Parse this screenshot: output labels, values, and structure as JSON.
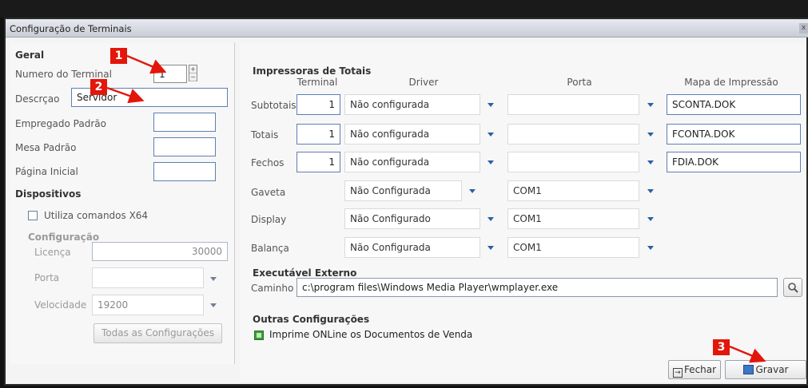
{
  "window": {
    "title": "Configuração de Terminais",
    "close_glyph": "x"
  },
  "left": {
    "section_geral": "Geral",
    "numero_terminal": {
      "label": "Numero do Terminal",
      "value": "1"
    },
    "descricao": {
      "label": "Descrçao",
      "value": "Servidor"
    },
    "empregado_padrao": {
      "label": "Empregado Padrão",
      "value": ""
    },
    "mesa_padrao": {
      "label": "Mesa Padrão",
      "value": ""
    },
    "pagina_inicial": {
      "label": "Página Inicial",
      "value": ""
    },
    "section_dispositivos": "Dispositivos",
    "utiliza_x64": {
      "label": "Utiliza comandos X64",
      "checked": false
    },
    "configuracao": {
      "title": "Configuração",
      "licenca": {
        "label": "Licença",
        "value": "30000"
      },
      "porta": {
        "label": "Porta",
        "value": ""
      },
      "velocidade": {
        "label": "Velocidade",
        "value": "19200"
      },
      "todas_button": "Todas as Configurações"
    }
  },
  "impressoras": {
    "title": "Impressoras de Totais",
    "headers": {
      "terminal": "Terminal",
      "driver": "Driver",
      "porta": "Porta",
      "mapa": "Mapa de Impressão"
    },
    "rows": [
      {
        "label": "Subtotais",
        "terminal": "1",
        "driver": "Não configurada",
        "porta": "",
        "mapa": "SCONTA.DOK"
      },
      {
        "label": "Totais",
        "terminal": "1",
        "driver": "Não configurada",
        "porta": "",
        "mapa": "FCONTA.DOK"
      },
      {
        "label": "Fechos",
        "terminal": "1",
        "driver": "Não configurada",
        "porta": "",
        "mapa": "FDIA.DOK"
      }
    ],
    "devices": [
      {
        "label": "Gaveta",
        "driver": "Não Configurada",
        "porta": "COM1"
      },
      {
        "label": "Display",
        "driver": "Não Configurado",
        "porta": "COM1"
      },
      {
        "label": "Balança",
        "driver": "Não Configurada",
        "porta": "COM1"
      }
    ]
  },
  "executavel": {
    "title": "Executável Externo",
    "caminho_label": "Caminho",
    "caminho_value": "c:\\program files\\Windows Media Player\\wmplayer.exe"
  },
  "outras": {
    "title": "Outras Configurações",
    "imprime_online": {
      "label": "Imprime ONLine os Documentos de Venda",
      "checked": true
    }
  },
  "buttons": {
    "fechar": "Fechar",
    "gravar": "Gravar"
  },
  "annotations": {
    "badge1": "1",
    "badge2": "2",
    "badge3": "3",
    "color": "#e3160b"
  }
}
